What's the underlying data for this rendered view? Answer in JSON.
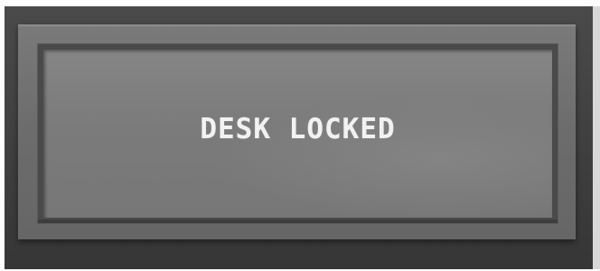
{
  "display": {
    "message": "DESK LOCKED"
  },
  "colors": {
    "device_body": "#3e3e3e",
    "bezel": "#707070",
    "screen": "#7d7d7d",
    "message_text": "#f2f2f2"
  }
}
